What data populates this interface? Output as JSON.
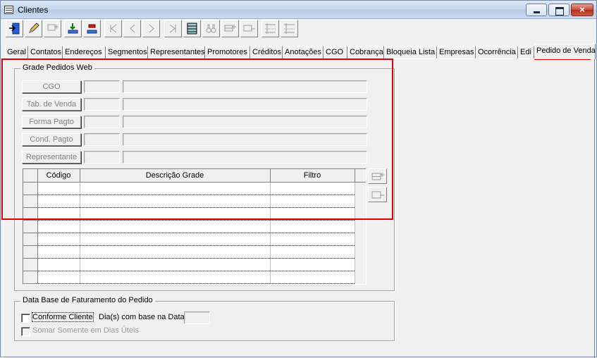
{
  "window": {
    "title": "Clientes",
    "close_glyph": "×"
  },
  "toolbar": {
    "buttons": [
      {
        "icon": "exit-door-icon",
        "enabled": true
      },
      {
        "icon": "pencil-icon",
        "enabled": true
      },
      {
        "icon": "new-record-icon",
        "enabled": false
      },
      {
        "icon": "save-tray-icon",
        "enabled": true
      },
      {
        "icon": "delete-tray-icon",
        "enabled": true
      },
      {
        "icon": "first-record-icon",
        "enabled": false
      },
      {
        "icon": "previous-record-icon",
        "enabled": false
      },
      {
        "icon": "next-record-icon",
        "enabled": false
      },
      {
        "icon": "last-record-icon",
        "enabled": false
      },
      {
        "icon": "grid-list-icon",
        "enabled": true
      },
      {
        "icon": "binoculars-icon",
        "enabled": false
      },
      {
        "icon": "insert-row-icon",
        "enabled": false
      },
      {
        "icon": "remove-row-icon",
        "enabled": false
      },
      {
        "icon": "field-list-icon",
        "enabled": false
      },
      {
        "icon": "field-list-alt-icon",
        "enabled": false
      }
    ]
  },
  "tabs": [
    {
      "label": "Geral"
    },
    {
      "label": "Contatos"
    },
    {
      "label": "Endereços"
    },
    {
      "label": "Segmentos"
    },
    {
      "label": "Representantes"
    },
    {
      "label": "Promotores"
    },
    {
      "label": "Créditos"
    },
    {
      "label": "Anotações"
    },
    {
      "label": "CGO"
    },
    {
      "label": "Cobrança"
    },
    {
      "label": "Bloqueia Lista"
    },
    {
      "label": "Empresas"
    },
    {
      "label": "Ocorrência"
    },
    {
      "label": "Edi"
    },
    {
      "label": "Pedido de Venda"
    }
  ],
  "grade": {
    "legend": "Grade Pedidos Web",
    "lookups": [
      {
        "label": "CGO",
        "code": "",
        "description": ""
      },
      {
        "label": "Tab. de Venda",
        "code": "",
        "description": ""
      },
      {
        "label": "Forma Pagto",
        "code": "",
        "description": ""
      },
      {
        "label": "Cond. Pagto",
        "code": "",
        "description": ""
      },
      {
        "label": "Representante",
        "code": "",
        "description": ""
      }
    ],
    "grid": {
      "columns": [
        "Código",
        "Descrição Grade",
        "Filtro"
      ],
      "rows": [
        [
          "",
          "",
          ""
        ],
        [
          "",
          "",
          ""
        ],
        [
          "",
          "",
          ""
        ],
        [
          "",
          "",
          ""
        ],
        [
          "",
          "",
          ""
        ],
        [
          "",
          "",
          ""
        ],
        [
          "",
          "",
          ""
        ],
        [
          "",
          "",
          ""
        ]
      ]
    }
  },
  "faturamento": {
    "legend": "Data Base de Faturamento do Pedido",
    "conforme_cliente": "Conforme Cliente",
    "dias_label": "Dia(s) com base na Data",
    "dias_value": "",
    "somar_dias_uteis": "Somar Somente em Dias Úteis"
  },
  "colors": {
    "highlight": "#e00000",
    "face": "#f0f0f0"
  }
}
